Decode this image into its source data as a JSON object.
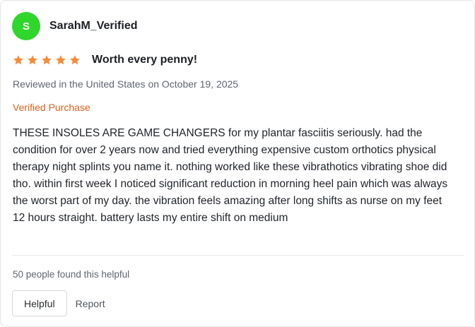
{
  "review": {
    "author": {
      "initial": "S",
      "name": "SarahM_Verified",
      "avatar_color": "#2fd62b"
    },
    "rating": {
      "value": 5,
      "max": 5,
      "star_color": "#f68b3c"
    },
    "title": "Worth every penny!",
    "meta": "Reviewed in the United States on October 19, 2025",
    "verified_label": "Verified Purchase",
    "verified_color": "#e8601c",
    "body": "THESE INSOLES ARE GAME CHANGERS for my plantar fasciitis seriously. had the condition for over 2 years now and tried everything expensive custom orthotics physical therapy night splints you name it. nothing worked like these vibrathotics vibrating shoe did tho. within first week I noticed significant reduction in morning heel pain which was always the worst part of my day. the vibration feels amazing after long shifts as nurse on my feet 12 hours straight. battery lasts my entire shift on medium",
    "helpful_count_text": "50 people found this helpful",
    "actions": {
      "helpful_label": "Helpful",
      "report_label": "Report"
    }
  },
  "icons": {
    "star": "star-icon"
  }
}
